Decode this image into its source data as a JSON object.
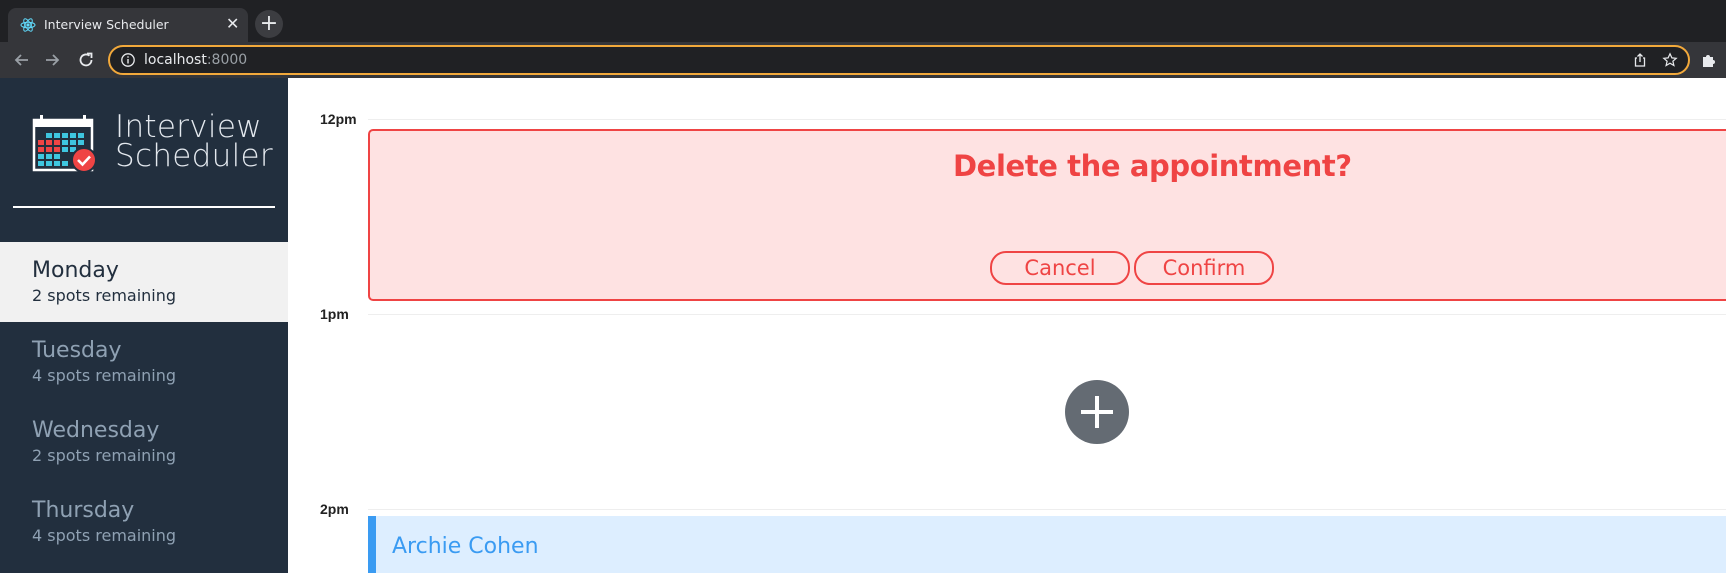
{
  "browser": {
    "tab_title": "Interview Scheduler",
    "close_glyph": "✕",
    "new_tab_glyph": "+",
    "url_host": "localhost",
    "url_port": ":8000"
  },
  "colors": {
    "sidebar_bg": "#222f3e",
    "danger": "#ef4444",
    "danger_bg": "#fee2e2",
    "appointment_accent": "#3a9bf2",
    "appointment_bg": "#ddeeff",
    "add_button": "#646b73"
  },
  "sidebar": {
    "brand_line1": "Interview",
    "brand_line2": "Scheduler",
    "days": [
      {
        "name": "Monday",
        "spots": "2 spots remaining",
        "selected": true
      },
      {
        "name": "Tuesday",
        "spots": "4 spots remaining",
        "selected": false
      },
      {
        "name": "Wednesday",
        "spots": "2 spots remaining",
        "selected": false
      },
      {
        "name": "Thursday",
        "spots": "4 spots remaining",
        "selected": false
      }
    ]
  },
  "schedule": {
    "times": [
      "12pm",
      "1pm",
      "2pm"
    ],
    "confirm": {
      "message": "Delete the appointment?",
      "cancel_label": "Cancel",
      "confirm_label": "Confirm"
    },
    "appointment": {
      "student": "Archie Cohen"
    }
  },
  "icons": {
    "favicon": "react-atom-icon",
    "back": "back-arrow-icon",
    "forward": "forward-arrow-icon",
    "reload": "reload-icon",
    "info": "site-info-icon",
    "share": "share-icon",
    "bookmark": "star-icon",
    "extensions": "puzzle-piece-icon",
    "logo": "calendar-check-icon",
    "add": "plus-icon"
  }
}
